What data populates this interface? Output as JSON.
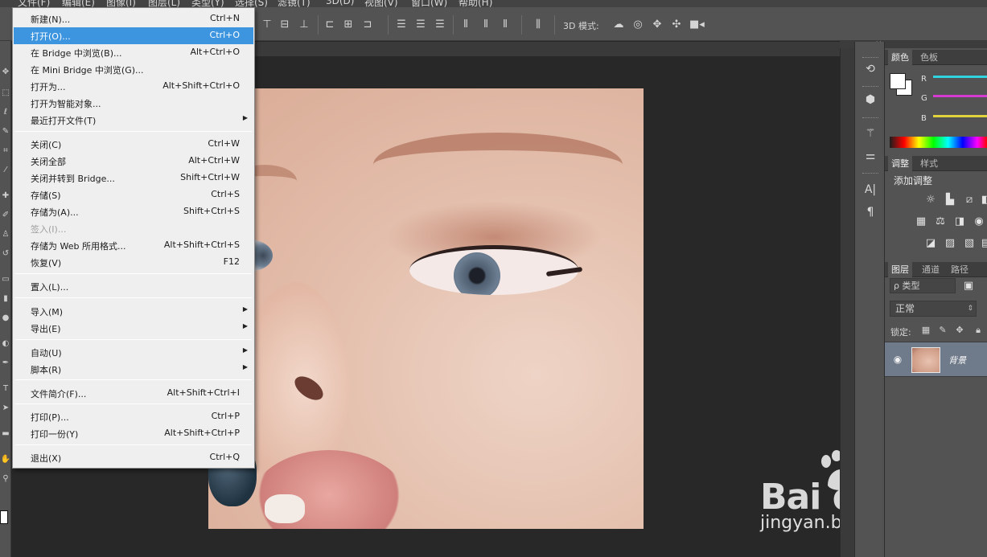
{
  "app": {
    "menubar": [
      "文件(F)",
      "编辑(E)",
      "图像(I)",
      "图层(L)",
      "类型(Y)",
      "选择(S)",
      "滤镜(T)",
      "3D(D)",
      "视图(V)",
      "窗口(W)",
      "帮助(H)"
    ]
  },
  "options_bar": {
    "mode_3d_label": "3D 模式:"
  },
  "file_menu": {
    "items": [
      {
        "label": "新建(N)...",
        "shortcut": "Ctrl+N"
      },
      {
        "label": "打开(O)...",
        "shortcut": "Ctrl+O",
        "highlighted": true
      },
      {
        "label": "在 Bridge 中浏览(B)...",
        "shortcut": "Alt+Ctrl+O"
      },
      {
        "label": "在 Mini Bridge 中浏览(G)...",
        "shortcut": ""
      },
      {
        "label": "打开为...",
        "shortcut": "Alt+Shift+Ctrl+O"
      },
      {
        "label": "打开为智能对象...",
        "shortcut": ""
      },
      {
        "label": "最近打开文件(T)",
        "shortcut": "",
        "submenu": true
      },
      {
        "label": "关闭(C)",
        "shortcut": "Ctrl+W"
      },
      {
        "label": "关闭全部",
        "shortcut": "Alt+Ctrl+W"
      },
      {
        "label": "关闭并转到 Bridge...",
        "shortcut": "Shift+Ctrl+W"
      },
      {
        "label": "存储(S)",
        "shortcut": "Ctrl+S"
      },
      {
        "label": "存储为(A)...",
        "shortcut": "Shift+Ctrl+S"
      },
      {
        "label": "签入(I)...",
        "shortcut": "",
        "disabled": true
      },
      {
        "label": "存储为 Web 所用格式...",
        "shortcut": "Alt+Shift+Ctrl+S"
      },
      {
        "label": "恢复(V)",
        "shortcut": "F12"
      },
      {
        "label": "置入(L)...",
        "shortcut": ""
      },
      {
        "label": "导入(M)",
        "shortcut": "",
        "submenu": true
      },
      {
        "label": "导出(E)",
        "shortcut": "",
        "submenu": true
      },
      {
        "label": "自动(U)",
        "shortcut": "",
        "submenu": true
      },
      {
        "label": "脚本(R)",
        "shortcut": "",
        "submenu": true
      },
      {
        "label": "文件简介(F)...",
        "shortcut": "Alt+Shift+Ctrl+I"
      },
      {
        "label": "打印(P)...",
        "shortcut": "Ctrl+P"
      },
      {
        "label": "打印一份(Y)",
        "shortcut": "Alt+Shift+Ctrl+P"
      },
      {
        "label": "退出(X)",
        "shortcut": "Ctrl+Q"
      }
    ]
  },
  "color_panel": {
    "tabs": [
      "颜色",
      "色板"
    ],
    "channels": [
      "R",
      "G",
      "B"
    ],
    "channel_colors": [
      "#2fd4e0",
      "#d63ad0",
      "#e0d43a"
    ],
    "foreground_color": "#ffffff"
  },
  "adjustments_panel": {
    "tabs": [
      "调整",
      "样式"
    ],
    "title": "添加调整"
  },
  "layers_panel": {
    "tabs": [
      "图层",
      "通道",
      "路径"
    ],
    "kind_filter": "ρ 类型",
    "blend_mode": "正常",
    "lock_label": "锁定:",
    "layers": [
      {
        "name": "背景",
        "visible": true
      }
    ]
  },
  "watermark": {
    "brand": "Bai du 经验",
    "url": "jingyan.baidu.com"
  }
}
